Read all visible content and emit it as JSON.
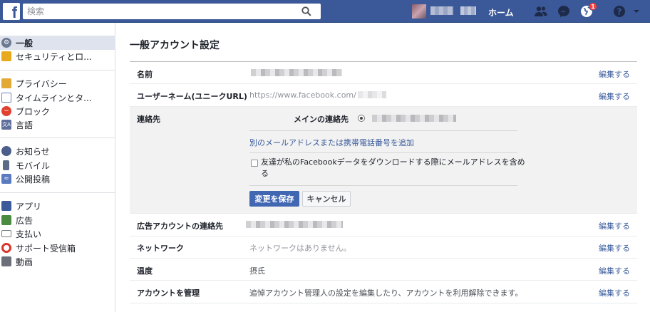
{
  "topbar": {
    "logo": "f",
    "search_placeholder": "検索",
    "home_label": "ホーム",
    "notification_count": "1"
  },
  "sidebar": {
    "items": [
      {
        "label": "一般",
        "icon": "gear-icon",
        "color": "#6d7a93"
      },
      {
        "label": "セキュリティとロ...",
        "icon": "shield-icon",
        "color": "#e8a91f"
      },
      {
        "label": "プライバシー",
        "icon": "lock-icon",
        "color": "#e3a935"
      },
      {
        "label": "タイムラインとタ...",
        "icon": "timeline-icon",
        "color": "#6d84b4"
      },
      {
        "label": "ブロック",
        "icon": "block-icon",
        "color": "#e0422f"
      },
      {
        "label": "言語",
        "icon": "language-icon",
        "color": "#5f6f9c"
      },
      {
        "label": "お知らせ",
        "icon": "globe-icon",
        "color": "#4b5f8a"
      },
      {
        "label": "モバイル",
        "icon": "mobile-icon",
        "color": "#5c6b87"
      },
      {
        "label": "公開投稿",
        "icon": "rss-icon",
        "color": "#5a7bbf"
      },
      {
        "label": "アプリ",
        "icon": "apps-icon",
        "color": "#3c5a99"
      },
      {
        "label": "広告",
        "icon": "ads-icon",
        "color": "#4a8c3f"
      },
      {
        "label": "支払い",
        "icon": "payment-icon",
        "color": "#7b7f86"
      },
      {
        "label": "サポート受信箱",
        "icon": "lifebuoy-icon",
        "color": "#d9342b"
      },
      {
        "label": "動画",
        "icon": "video-icon",
        "color": "#6a6f78"
      }
    ]
  },
  "main": {
    "title": "一般アカウント設定",
    "edit_label": "編集する",
    "rows": {
      "name": {
        "label": "名前"
      },
      "username": {
        "label": "ユーザーネーム(ユニークURL)",
        "value": "https://www.facebook.com/"
      },
      "contact": {
        "label": "連絡先",
        "primary_label": "メインの連絡先",
        "add_link": "別のメールアドレスまたは携帯電話番号を追加",
        "checkbox_text": "友達が私のFacebookデータをダウンロードする際にメールアドレスを含める",
        "save_button": "変更を保存",
        "cancel_button": "キャンセル"
      },
      "ad_contact": {
        "label": "広告アカウントの連絡先"
      },
      "network": {
        "label": "ネットワーク",
        "value": "ネットワークはありません。"
      },
      "temperature": {
        "label": "温度",
        "value": "摂氏"
      },
      "manage": {
        "label": "アカウントを管理",
        "value": "追悼アカウント管理人の設定を編集したり、アカウントを利用解除できます。"
      }
    }
  }
}
